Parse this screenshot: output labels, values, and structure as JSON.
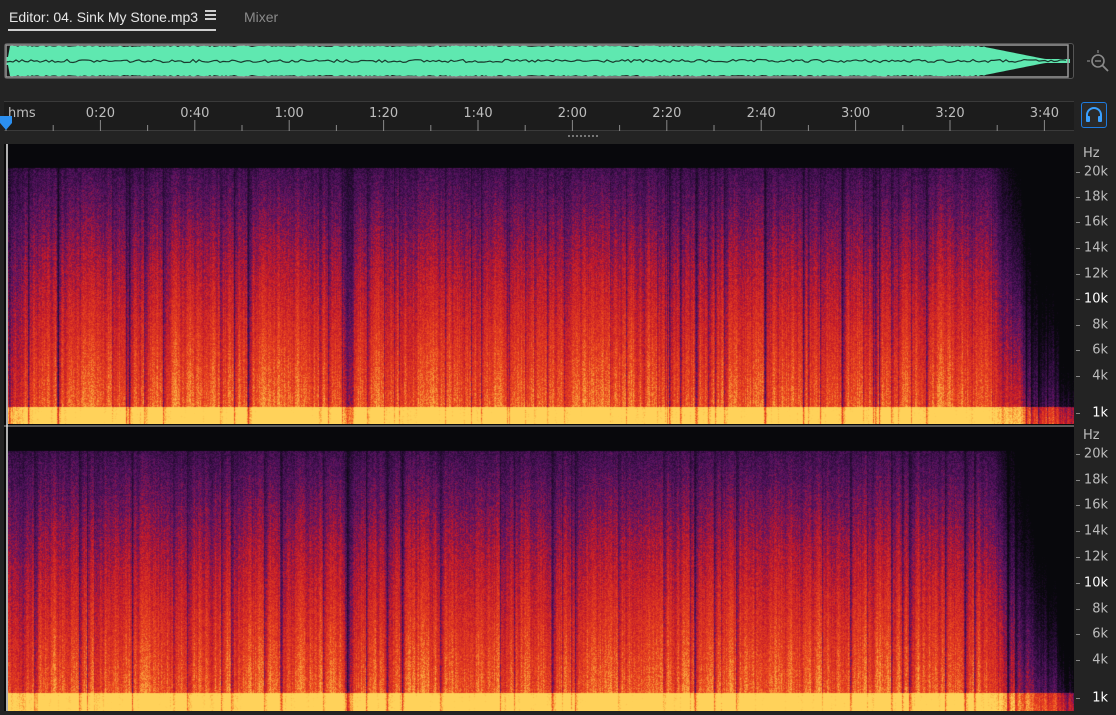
{
  "tabs": {
    "editor_label": "Editor: 04. Sink My Stone.mp3",
    "mixer_label": "Mixer"
  },
  "icons": {
    "panel_menu": "hamburger-menu-icon",
    "zoom": "zoom-magnifier-icon",
    "monitor": "headphones-monitor-icon",
    "playhead": "playhead-marker-icon"
  },
  "ruler": {
    "unit": "hms",
    "labels": [
      "0:20",
      "0:40",
      "1:00",
      "1:20",
      "1:40",
      "2:00",
      "2:20",
      "2:40",
      "3:00",
      "3:20",
      "3:40"
    ]
  },
  "frequency_axis": {
    "unit": "Hz",
    "labels": [
      "20k",
      "18k",
      "16k",
      "14k",
      "12k",
      "10k",
      "8k",
      "6k",
      "4k",
      "1k"
    ]
  },
  "colors": {
    "overview_waveform": "#5fe8b0",
    "accent": "#1e7be0",
    "spectrogram_low": "#0a0a0a",
    "spectrogram_mid": "#c0182b",
    "spectrogram_high": "#ffd25a"
  }
}
